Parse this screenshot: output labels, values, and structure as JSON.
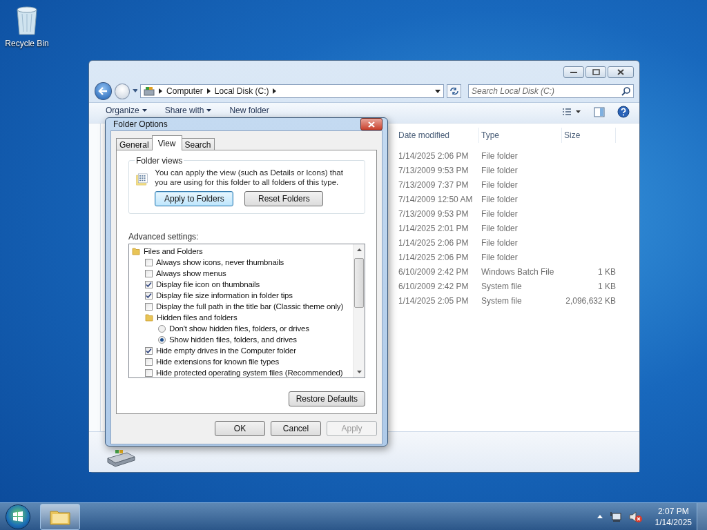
{
  "desktop_icons": [
    {
      "label": "Recycle Bin"
    }
  ],
  "explorer": {
    "address_path": [
      "Computer",
      "Local Disk (C:)"
    ],
    "search_placeholder": "Search Local Disk (C:)",
    "toolbar": [
      {
        "label": "Organize",
        "has_menu": true
      },
      {
        "label": "Share with",
        "has_menu": true
      },
      {
        "label": "New folder",
        "has_menu": false
      }
    ],
    "columns": [
      "Date modified",
      "Type",
      "Size"
    ],
    "rows": [
      {
        "date": "1/14/2025 2:06 PM",
        "type": "File folder",
        "size": ""
      },
      {
        "date": "7/13/2009 9:53 PM",
        "type": "File folder",
        "size": ""
      },
      {
        "date": "7/13/2009 7:37 PM",
        "type": "File folder",
        "size": ""
      },
      {
        "date": "7/14/2009 12:50 AM",
        "type": "File folder",
        "size": ""
      },
      {
        "date": "7/13/2009 9:53 PM",
        "type": "File folder",
        "size": ""
      },
      {
        "date": "1/14/2025 2:01 PM",
        "type": "File folder",
        "size": ""
      },
      {
        "date": "1/14/2025 2:06 PM",
        "type": "File folder",
        "size": ""
      },
      {
        "date": "1/14/2025 2:06 PM",
        "type": "File folder",
        "size": ""
      },
      {
        "date": "6/10/2009 2:42 PM",
        "type": "Windows Batch File",
        "size": "1 KB"
      },
      {
        "date": "6/10/2009 2:42 PM",
        "type": "System file",
        "size": "1 KB"
      },
      {
        "date": "1/14/2025 2:05 PM",
        "type": "System file",
        "size": "2,096,632 KB"
      }
    ]
  },
  "dialog": {
    "title": "Folder Options",
    "tabs": [
      {
        "label": "General",
        "selected": false
      },
      {
        "label": "View",
        "selected": true
      },
      {
        "label": "Search",
        "selected": false
      }
    ],
    "folder_views": {
      "legend": "Folder views",
      "description": "You can apply the view (such as Details or Icons) that you are using for this folder to all folders of this type.",
      "buttons": [
        {
          "label": "Apply to Folders",
          "focused": true
        },
        {
          "label": "Reset Folders",
          "focused": false
        }
      ]
    },
    "advanced_label": "Advanced settings:",
    "settings": [
      {
        "kind": "folder",
        "label": "Files and Folders",
        "children": [
          {
            "kind": "checkbox",
            "label": "Always show icons, never thumbnails",
            "checked": false
          },
          {
            "kind": "checkbox",
            "label": "Always show menus",
            "checked": false
          },
          {
            "kind": "checkbox",
            "label": "Display file icon on thumbnails",
            "checked": true
          },
          {
            "kind": "checkbox",
            "label": "Display file size information in folder tips",
            "checked": true
          },
          {
            "kind": "checkbox",
            "label": "Display the full path in the title bar (Classic theme only)",
            "checked": false
          },
          {
            "kind": "folder",
            "label": "Hidden files and folders",
            "children": [
              {
                "kind": "radio",
                "label": "Don't show hidden files, folders, or drives",
                "checked": false
              },
              {
                "kind": "radio",
                "label": "Show hidden files, folders, and drives",
                "checked": true
              }
            ]
          },
          {
            "kind": "checkbox",
            "label": "Hide empty drives in the Computer folder",
            "checked": true
          },
          {
            "kind": "checkbox",
            "label": "Hide extensions for known file types",
            "checked": false
          },
          {
            "kind": "checkbox",
            "label": "Hide protected operating system files (Recommended)",
            "checked": false
          }
        ]
      }
    ],
    "restore_button": "Restore Defaults",
    "buttons": [
      {
        "label": "OK",
        "disabled": false
      },
      {
        "label": "Cancel",
        "disabled": false
      },
      {
        "label": "Apply",
        "disabled": true
      }
    ]
  },
  "taskbar": {
    "time": "2:07 PM",
    "date": "1/14/2025"
  }
}
